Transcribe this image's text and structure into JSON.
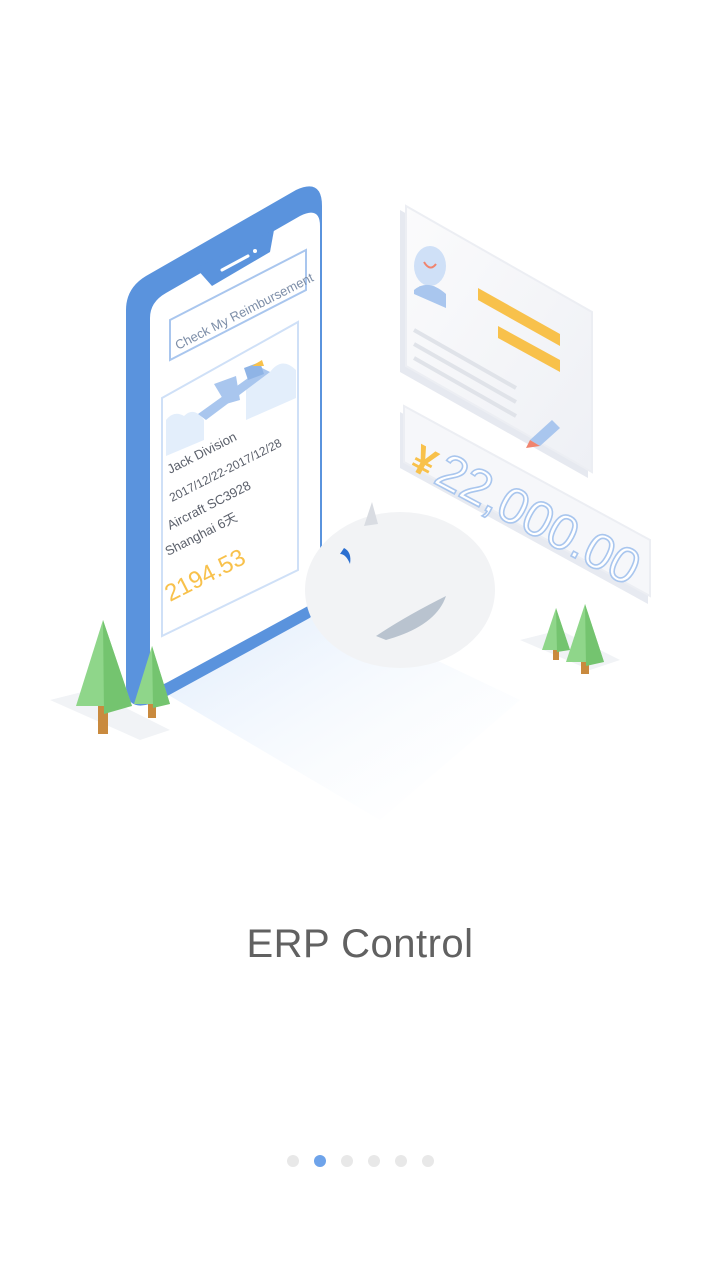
{
  "onboarding": {
    "headline": "ERP Control",
    "pager": {
      "total": 6,
      "active_index": 1,
      "active_color": "#6ea3ea",
      "inactive_color": "#e8e8e8"
    }
  },
  "illustration": {
    "phone": {
      "header_button": "Check My Reimbursement",
      "name_line": "Jack  Division",
      "date_line": "2017/12/22-2017/12/28",
      "flight_line": "Aircraft   SC3928",
      "city_line": "Shanghai  6天",
      "amount": "2194.53"
    },
    "amount_card": {
      "currency": "¥",
      "value": "22,000.00"
    },
    "colors": {
      "phone_body": "#5a93dd",
      "accent_yellow": "#f8c14b",
      "tree_green": "#8fd68a",
      "card_grey": "#f4f5f8"
    }
  }
}
